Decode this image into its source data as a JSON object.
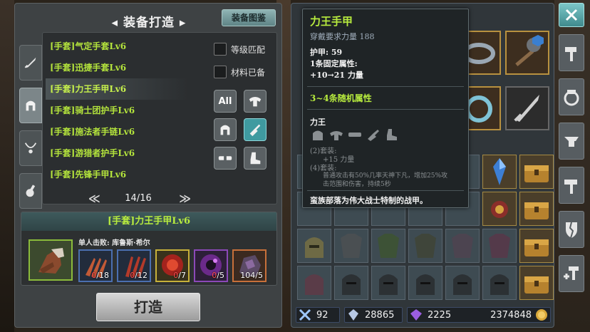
{
  "craft": {
    "title": "装备打造",
    "codex_button": "装备图鉴",
    "categories": [
      "sword-icon",
      "helmet-icon",
      "necklace-icon",
      "potion-icon"
    ],
    "recipes": [
      "[手套]气定手套Lv6",
      "[手套]迅捷手套Lv6",
      "[手套]力王手甲Lv6",
      "[手套]骑士团护手Lv6",
      "[手套]施法者手链Lv6",
      "[手套]游猎者护手Lv6",
      "[手套]先锋手甲Lv6"
    ],
    "selected_index": 2,
    "options": {
      "level_match": "等级匹配",
      "materials_ready": "材料已备"
    },
    "filter_all": "All",
    "pager": {
      "prev": "≪",
      "page": "14/16",
      "next": "≫"
    },
    "detail": {
      "name": "[手套]力王手甲Lv6",
      "drop_source": "单人击败: 库鲁斯·希尔",
      "materials": [
        {
          "have": "0",
          "need": "/18",
          "color": "blue",
          "icon": "claw-icon"
        },
        {
          "have": "0",
          "need": "/12",
          "color": "blue",
          "icon": "claw-icon"
        },
        {
          "have": "0",
          "need": "/7",
          "color": "yellow",
          "icon": "red-orb-icon"
        },
        {
          "have": "0",
          "need": "/5",
          "color": "purple",
          "icon": "purple-ring-icon"
        },
        {
          "have": "104",
          "need": "/5",
          "color": "orange",
          "icon": "ore-icon"
        }
      ]
    },
    "forge_button": "打造"
  },
  "tooltip": {
    "name": "力王手甲",
    "requirement": "穿戴要求力量 188",
    "armor": "护甲:  59",
    "fixed_attr_title": "1条固定属性:",
    "fixed_attr_value": "+10→21 力量",
    "random_attr": "3~4条随机属性",
    "set_name": "力王",
    "set_bonus_2_title": "(2)套装:",
    "set_bonus_2_value": "+15 力量",
    "set_bonus_4_title": "(4)套装:",
    "set_bonus_4_value": "普通攻击有50%几率天神下凡，增加25%攻",
    "set_bonus_4_value2": "击范围和伤害，持续5秒",
    "description": "蛮族部落为伟大战士特制的战甲。"
  },
  "currency": {
    "attack": "92",
    "crystal": "28865",
    "gem": "2225",
    "gold": "2374848"
  },
  "colors": {
    "rarity_green": "#b8ec3e",
    "accent_teal": "#3f9aa0",
    "gold_border": "#b8913f"
  }
}
